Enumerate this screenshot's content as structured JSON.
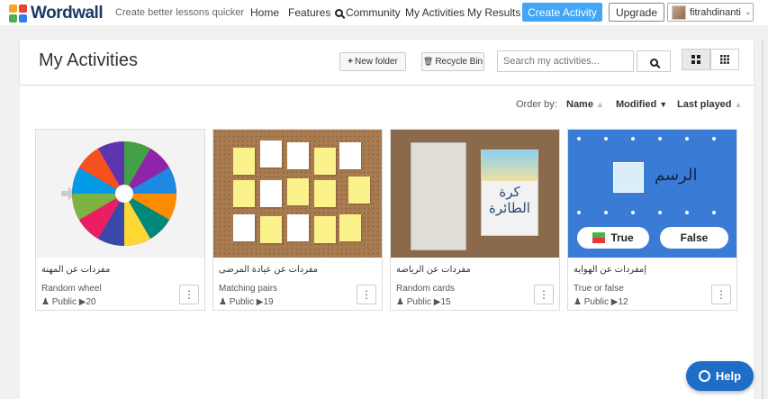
{
  "nav": {
    "logo": "Wordwall",
    "tagline": "Create better lessons quicker",
    "home": "Home",
    "features": "Features",
    "community": "Community",
    "my_activities": "My Activities",
    "my_results": "My Results",
    "create_activity": "Create Activity",
    "upgrade": "Upgrade",
    "username": "fitrahdinanti"
  },
  "header": {
    "title": "My Activities",
    "new_folder": "New folder",
    "recycle_bin": "Recycle Bin",
    "search_placeholder": "Search my activities..."
  },
  "order": {
    "label": "Order by:",
    "name": "Name",
    "modified": "Modified",
    "last_played": "Last played"
  },
  "cards": [
    {
      "title": "مفردات عن المهنة",
      "type": "Random wheel",
      "visibility": "Public",
      "plays": "20"
    },
    {
      "title": "مفردات عن عيادة المرضى",
      "type": "Matching pairs",
      "visibility": "Public",
      "plays": "19"
    },
    {
      "title": "مفردات عن الرياضة",
      "type": "Random cards",
      "visibility": "Public",
      "plays": "15"
    },
    {
      "title": "إمفردات عن الهواية",
      "type": "True or false",
      "visibility": "Public",
      "plays": "12"
    }
  ],
  "thumbs": {
    "card3_word": "كرة الطائرة",
    "card4_word": "الرسم",
    "card4_true": "True",
    "card4_false": "False"
  },
  "help": "Help",
  "colors": {
    "accent": "#42a5f5",
    "help": "#1e6dc7",
    "logo_text": "#1c3a66"
  }
}
